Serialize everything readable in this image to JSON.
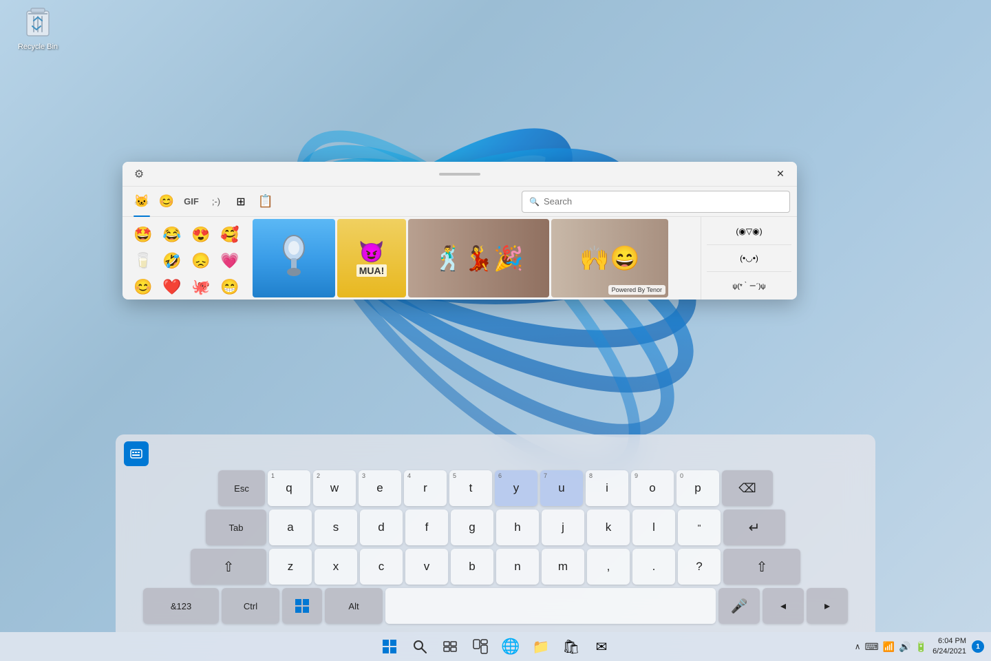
{
  "desktop": {
    "recycle_bin_label": "Recycle Bin",
    "recycle_bin_icon": "🗑️"
  },
  "emoji_panel": {
    "settings_icon": "⚙",
    "close_icon": "✕",
    "drag_handle": "",
    "tabs": [
      {
        "id": "emoji",
        "label": "🐱",
        "icon": "🐱",
        "active": true
      },
      {
        "id": "smiley",
        "label": "😊",
        "icon": "😊",
        "active": false
      },
      {
        "id": "gif",
        "label": "GIF",
        "icon": "GIF",
        "active": false
      },
      {
        "id": "kaomoji",
        "label": ";-)",
        "icon": ";-)",
        "active": false
      },
      {
        "id": "symbols",
        "label": "⊞",
        "icon": "⊞",
        "active": false
      },
      {
        "id": "clipboard",
        "label": "📋",
        "icon": "📋",
        "active": false
      }
    ],
    "search_placeholder": "Search",
    "emojis": [
      "🤩",
      "😂",
      "😍",
      "🥰",
      "🥛",
      "🤣",
      "😞",
      "💗",
      "😊",
      "❤️",
      "🐙",
      "😁"
    ],
    "gifs": [
      {
        "id": "gif1",
        "label": "paperclip dance",
        "bg": "#4a9fd4"
      },
      {
        "id": "gif2",
        "label": "MUA minion",
        "bg": "#e8c850",
        "text": "MUA!"
      },
      {
        "id": "gif3",
        "label": "crowd dancing",
        "bg": "#c0a090"
      },
      {
        "id": "gif4",
        "label": "excited man",
        "bg": "#d0c0b0"
      }
    ],
    "powered_by_tenor": "Powered By Tenor",
    "kaomoji": [
      {
        "text": "(◉▽◉)",
        "selected": false
      },
      {
        "text": "(•◡•)",
        "selected": false
      },
      {
        "text": "ψ(*｀ー´)ψ",
        "selected": false
      }
    ]
  },
  "keyboard": {
    "mode_icon": "⌨",
    "rows": [
      {
        "keys": [
          {
            "label": "Esc",
            "type": "func",
            "size": "sm"
          },
          {
            "label": "q",
            "number": "1",
            "type": "letter",
            "size": "sm"
          },
          {
            "label": "w",
            "number": "2",
            "type": "letter",
            "size": "sm"
          },
          {
            "label": "e",
            "number": "3",
            "type": "letter",
            "size": "sm"
          },
          {
            "label": "r",
            "number": "4",
            "type": "letter",
            "size": "sm"
          },
          {
            "label": "t",
            "number": "5",
            "type": "letter",
            "size": "sm"
          },
          {
            "label": "y",
            "number": "6",
            "type": "letter",
            "size": "sm",
            "active": true
          },
          {
            "label": "u",
            "number": "7",
            "type": "letter",
            "size": "sm",
            "active": true
          },
          {
            "label": "i",
            "number": "8",
            "type": "letter",
            "size": "sm"
          },
          {
            "label": "o",
            "number": "9",
            "type": "letter",
            "size": "sm"
          },
          {
            "label": "p",
            "number": "0",
            "type": "letter",
            "size": "sm"
          },
          {
            "label": "⌫",
            "type": "func",
            "size": "md"
          }
        ]
      },
      {
        "keys": [
          {
            "label": "Tab",
            "type": "func",
            "size": "lg"
          },
          {
            "label": "a",
            "type": "letter",
            "size": "sm"
          },
          {
            "label": "s",
            "type": "letter",
            "size": "sm"
          },
          {
            "label": "d",
            "type": "letter",
            "size": "sm"
          },
          {
            "label": "f",
            "type": "letter",
            "size": "sm"
          },
          {
            "label": "g",
            "type": "letter",
            "size": "sm"
          },
          {
            "label": "h",
            "type": "letter",
            "size": "sm"
          },
          {
            "label": "j",
            "type": "letter",
            "size": "sm"
          },
          {
            "label": "k",
            "type": "letter",
            "size": "sm"
          },
          {
            "label": "l",
            "type": "letter",
            "size": "sm"
          },
          {
            "label": "\"",
            "type": "letter",
            "size": "sm"
          },
          {
            "label": "↵",
            "type": "func",
            "size": "xl"
          }
        ]
      },
      {
        "keys": [
          {
            "label": "⇧",
            "type": "func",
            "size": "xxl"
          },
          {
            "label": "z",
            "type": "letter",
            "size": "sm"
          },
          {
            "label": "x",
            "type": "letter",
            "size": "sm"
          },
          {
            "label": "c",
            "type": "letter",
            "size": "sm"
          },
          {
            "label": "v",
            "type": "letter",
            "size": "sm"
          },
          {
            "label": "b",
            "type": "letter",
            "size": "sm"
          },
          {
            "label": "n",
            "type": "letter",
            "size": "sm"
          },
          {
            "label": "m",
            "type": "letter",
            "size": "sm"
          },
          {
            "label": ",",
            "type": "letter",
            "size": "sm"
          },
          {
            "label": ".",
            "type": "letter",
            "size": "sm"
          },
          {
            "label": "?",
            "type": "letter",
            "size": "sm"
          },
          {
            "label": "⇧",
            "type": "func",
            "size": "xxl"
          }
        ]
      },
      {
        "keys": [
          {
            "label": "&123",
            "type": "func",
            "size": "xxl"
          },
          {
            "label": "Ctrl",
            "type": "func",
            "size": "xl"
          },
          {
            "label": "⊞",
            "type": "func",
            "size": "md"
          },
          {
            "label": "Alt",
            "type": "func",
            "size": "xl"
          },
          {
            "label": "",
            "type": "space"
          },
          {
            "label": "🎤",
            "type": "func",
            "size": "md"
          },
          {
            "label": "◂",
            "type": "func",
            "size": "md"
          },
          {
            "label": "▸",
            "type": "func",
            "size": "md"
          }
        ]
      }
    ]
  },
  "taskbar": {
    "start_icon": "⊞",
    "search_icon": "🔍",
    "taskview_icon": "❐",
    "widgets_icon": "⊟",
    "edge_icon": "🌐",
    "explorer_icon": "📁",
    "store_icon": "🛍",
    "mail_icon": "✉",
    "time": "6:04 PM",
    "date": "6/24/2021",
    "notification_count": "1"
  }
}
